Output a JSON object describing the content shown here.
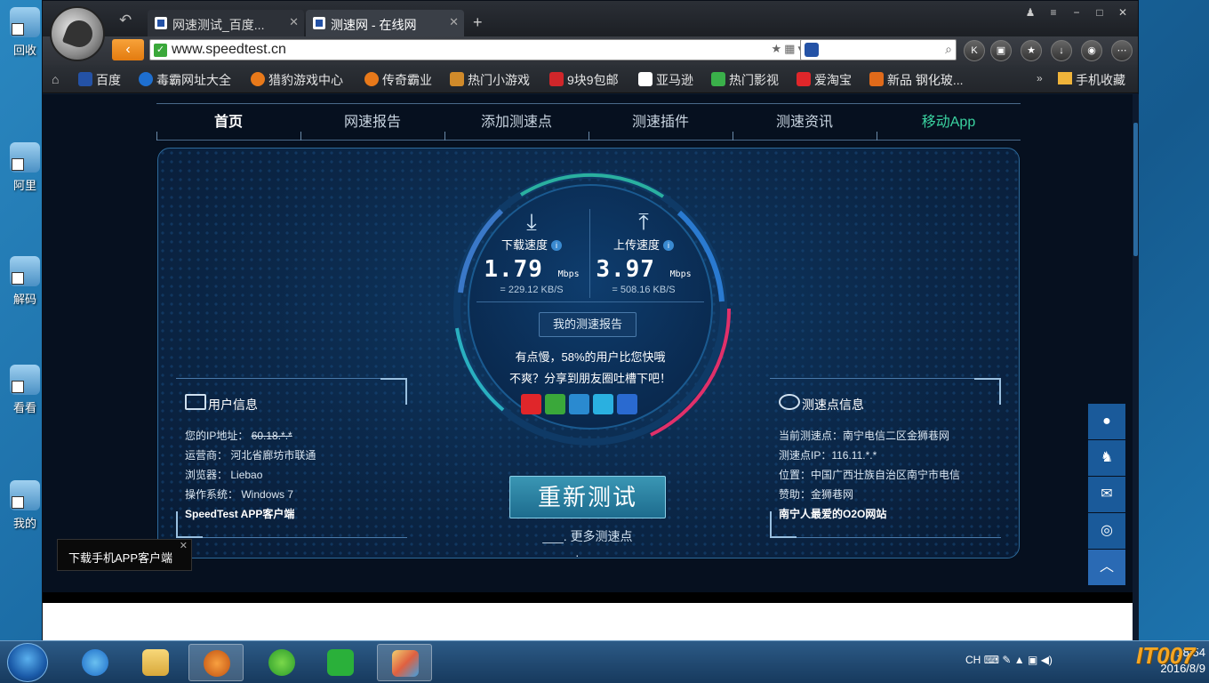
{
  "desktop": {
    "icons": [
      {
        "label": "回收"
      },
      {
        "label": "阿里"
      },
      {
        "label": "解码"
      },
      {
        "label": "看看"
      },
      {
        "label": "我的"
      }
    ]
  },
  "tabs": [
    {
      "title": "网速测试_百度..."
    },
    {
      "title": "测速网 - 在线网"
    }
  ],
  "address": {
    "url": "www.speedtest.cn"
  },
  "bookmarks": [
    {
      "label": "百度",
      "color": "#2452a6"
    },
    {
      "label": "毒霸网址大全",
      "color": "#1e6fd0"
    },
    {
      "label": "猎豹游戏中心",
      "color": "#e8791a"
    },
    {
      "label": "传奇霸业",
      "color": "#e8791a"
    },
    {
      "label": "热门小游戏",
      "color": "#d08a2a"
    },
    {
      "label": "9块9包邮",
      "color": "#d0262a"
    },
    {
      "label": "亚马逊",
      "color": "#ffffff"
    },
    {
      "label": "热门影视",
      "color": "#3ab04a"
    },
    {
      "label": "爱淘宝",
      "color": "#e0262a"
    },
    {
      "label": "新品 钢化玻...",
      "color": "#e06a1a"
    }
  ],
  "mobile_bookmarks": "手机收藏",
  "site_nav": [
    "首页",
    "网速报告",
    "添加测速点",
    "测速插件",
    "测速资讯",
    "移动App"
  ],
  "speed": {
    "download_label": "下载速度",
    "download_value": "1.79",
    "download_unit": "Mbps",
    "download_kbs": "= 229.12 KB/S",
    "upload_label": "上传速度",
    "upload_value": "3.97",
    "upload_unit": "Mbps",
    "upload_kbs": "= 508.16 KB/S",
    "info_icon": "i"
  },
  "report_button": "我的测速报告",
  "message1": "有点慢，58%的用户比您快哦",
  "message2": "不爽？分享到朋友圈吐槽下吧！",
  "share_icons": [
    {
      "name": "weibo-icon",
      "color": "#e0262a"
    },
    {
      "name": "wechat-icon",
      "color": "#3aa83a"
    },
    {
      "name": "qzone-icon",
      "color": "#2a8ad0"
    },
    {
      "name": "tencent-weibo-icon",
      "color": "#2ab0e0"
    },
    {
      "name": "more-share-icon",
      "color": "#2a6ad0"
    }
  ],
  "user_info": {
    "title": "用户信息",
    "lines": [
      {
        "label": "您的IP地址：",
        "value": "60.18.*.*"
      },
      {
        "label": "运营商：",
        "value": "河北省廊坊市联通"
      },
      {
        "label": "浏览器：",
        "value": "Liebao"
      },
      {
        "label": "操作系统：",
        "value": "Windows 7"
      }
    ],
    "footer": "SpeedTest APP客户端"
  },
  "node_info": {
    "title": "测速点信息",
    "lines": [
      "当前测速点：南宁电信二区金狮巷网",
      "测速点IP：116.11.*.*",
      "位置：中国广西壮族自治区南宁市电信",
      "赞助：金狮巷网"
    ],
    "footer": "南宁人最爱的O2O网站"
  },
  "retest_button": "重新测试",
  "more_nodes": "更多测速点",
  "download_popup": "下载手机APP客户端",
  "taskbar": {
    "lang": "CH",
    "time": "18:54",
    "date": "2016/8/9"
  },
  "watermark": "IT007"
}
